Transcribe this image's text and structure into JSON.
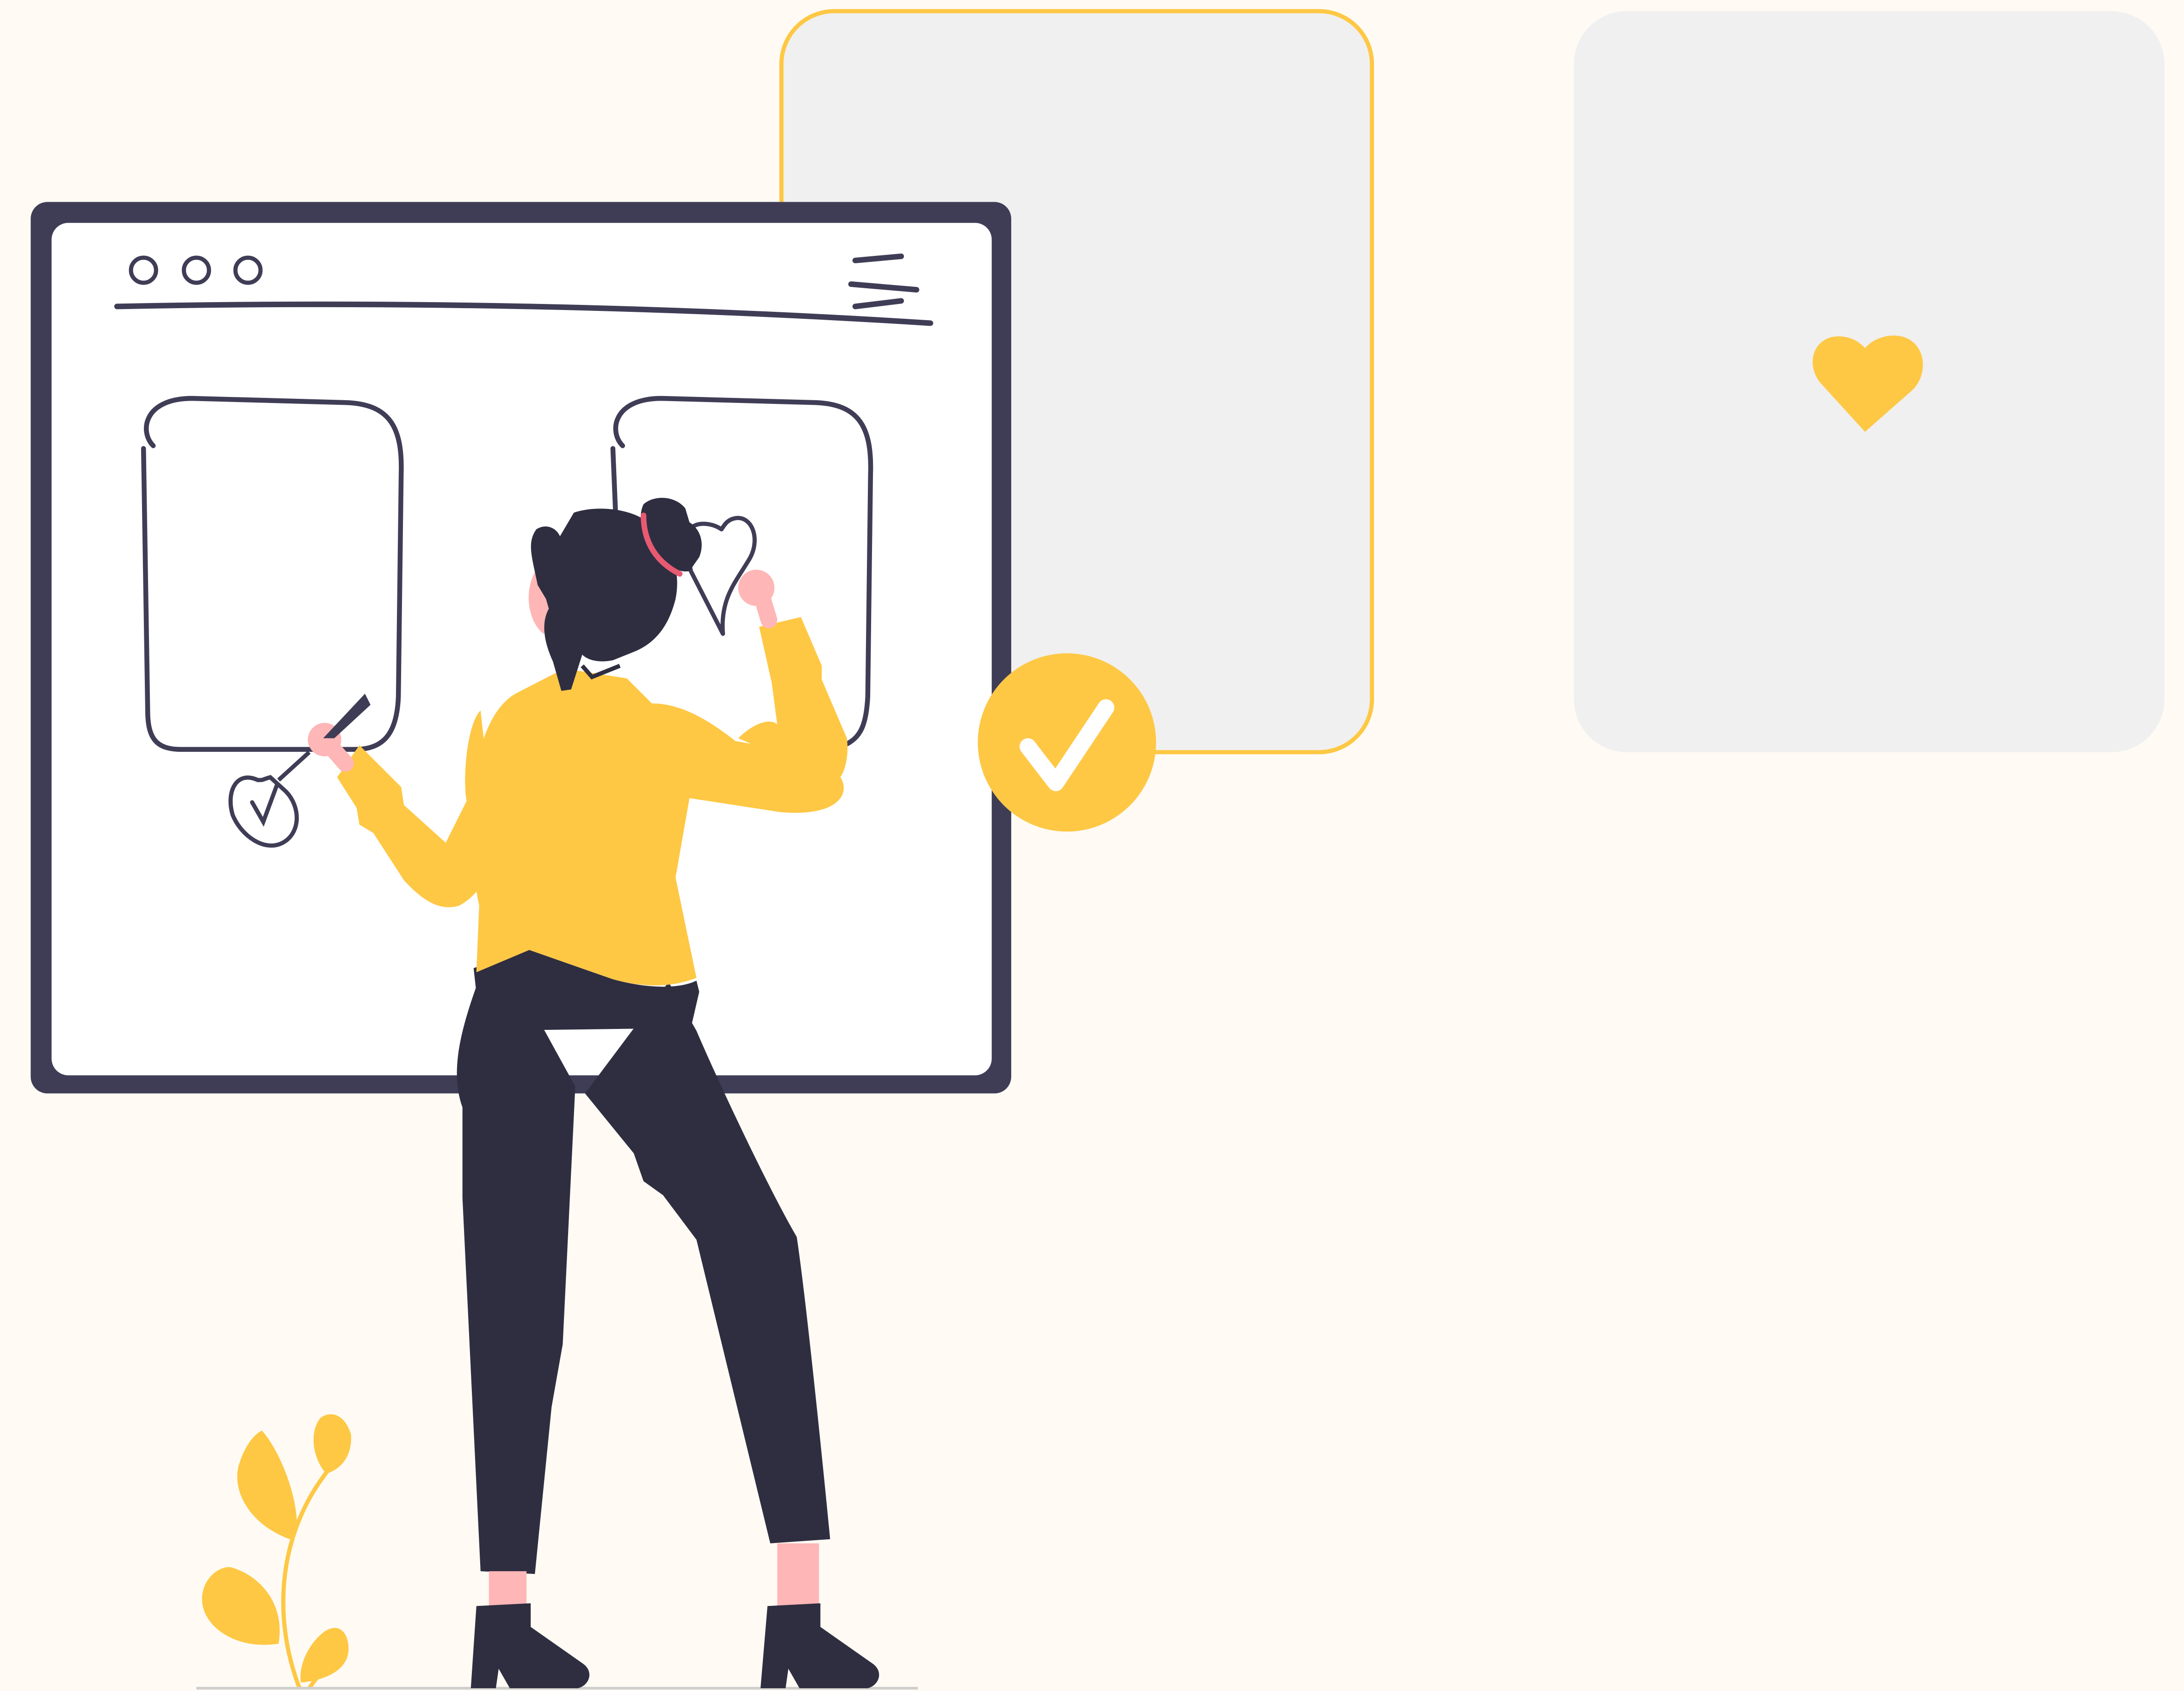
{
  "illustration": {
    "colors": {
      "background": "#fffbf4",
      "accent": "#fec845",
      "card_fill": "#f0f0f0",
      "frame_dark": "#3f3d56",
      "figure_dark": "#2f2e41",
      "skin": "#ffb6b6",
      "hair_accent": "#e85a71",
      "white": "#ffffff"
    },
    "icons": {
      "window_controls": "three-dot-window-controls",
      "menu": "hamburger-menu-icon",
      "left_card_mark": "check-icon",
      "right_card_mark": "heart-icon",
      "floating_badge": "check-circle-icon",
      "gray_card_mark": "heart-icon"
    }
  }
}
